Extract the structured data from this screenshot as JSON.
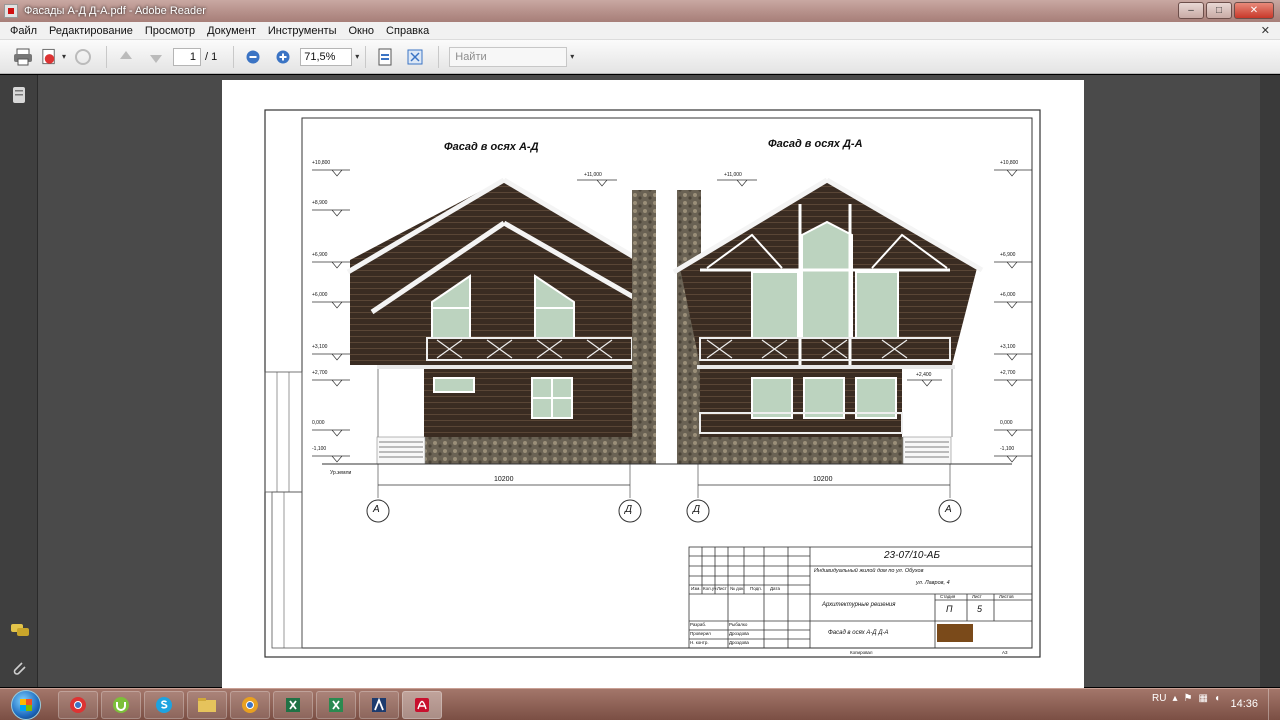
{
  "window": {
    "title": "Фасады А-Д Д-А.pdf - Adobe Reader",
    "controls": {
      "minimize": "–",
      "maximize": "□",
      "close": "✕"
    }
  },
  "menu": {
    "items": [
      "Файл",
      "Редактирование",
      "Просмотр",
      "Документ",
      "Инструменты",
      "Окно",
      "Справка"
    ],
    "close": "✕"
  },
  "toolbar": {
    "page_current": "1",
    "page_total": "/ 1",
    "zoom": "71,5%",
    "find_placeholder": "Найти"
  },
  "drawing": {
    "facade_left_title": "Фасад в осях А-Д",
    "facade_right_title": "Фасад в осях Д-А",
    "elevations": [
      "+10,800",
      "+8,900",
      "+6,900",
      "+6,000",
      "+3,100",
      "+2,700",
      "0,000",
      "-1,100"
    ],
    "ground_label": "Ур.земли",
    "chimney_mark": "+11,000",
    "bay_mark": "+2,400",
    "dimension": "10200",
    "axes_left": [
      "А",
      "Д"
    ],
    "axes_right": [
      "Д",
      "А"
    ]
  },
  "title_block": {
    "doc_code": "23-07/10-АБ",
    "project_line1": "Индивидуальный жилой дом по ул. Обухов",
    "project_line2": "ул. Лавров, 4",
    "section": "Архитектурные решения",
    "sheet_title": "Фасад в осях А-Д Д-А",
    "stage_label": "Стадия",
    "sheet_label": "Лист",
    "sheets_label": "Листов",
    "stage_value": "П",
    "sheet_value": "5",
    "roles": [
      "Разраб.",
      "Проверил",
      "Н. контр."
    ],
    "role_names": [
      "Рыбалко",
      "Дроздова",
      "Дроздова"
    ],
    "header_cells": [
      "Изм.",
      "Кол.уч",
      "Лист",
      "№ док.",
      "Подп.",
      "Дата"
    ],
    "footer": "Копировал",
    "format": "А3"
  },
  "taskbar": {
    "clock": "14:36",
    "lang": "RU"
  }
}
